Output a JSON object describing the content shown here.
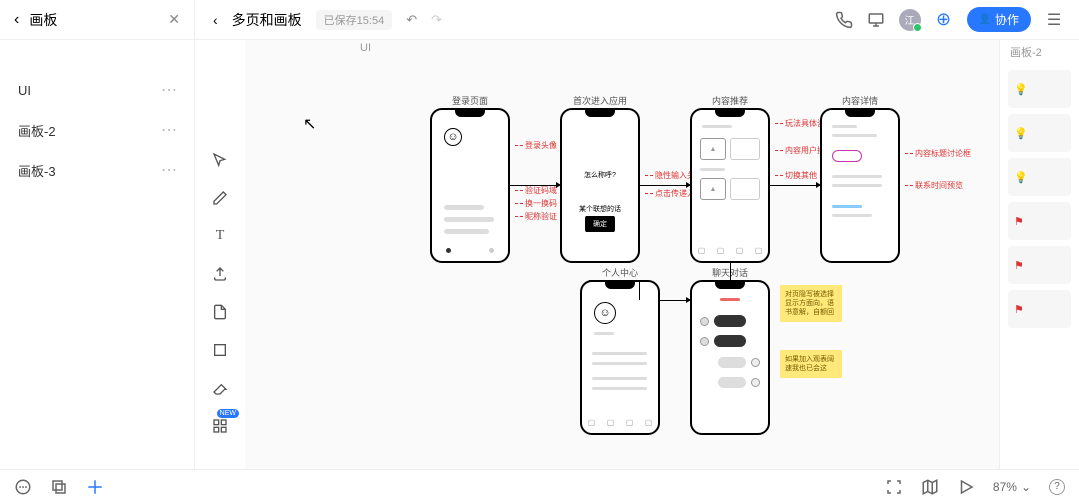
{
  "header": {
    "left_title": "画板",
    "doc_title": "多页和画板",
    "saved_label": "已保存15:54",
    "avatar_text": "江",
    "collab_label": "协作"
  },
  "sidebar": {
    "items": [
      {
        "label": "UI"
      },
      {
        "label": "画板-2"
      },
      {
        "label": "画板-3"
      }
    ]
  },
  "canvas": {
    "label_ui": "UI",
    "label_right": "画板-2",
    "phones": {
      "p1": "登录页面",
      "p2": "首次进入应用",
      "p3": "内容推荐",
      "p4": "内容详情",
      "p5": "个人中心",
      "p6": "聊天对话"
    },
    "p2_text1": "怎么称呼?",
    "p2_text2": "某个联想的话",
    "p2_btn": "确定",
    "annotations": {
      "a1": "登录头像",
      "a2": "验证码域",
      "a3": "换一换码",
      "a4": "昵称验证",
      "a5": "隐性输入关键词",
      "a6": "点击传递入库子",
      "a7": "玩法具体咨hah",
      "a8": "内容用户撰述标签",
      "a9": "切换其他",
      "a10": "内容标题讨论框",
      "a11": "联系时间预览"
    },
    "notes": {
      "n1": "对页隐写被选择显示方面向，语书意解，自额回",
      "n2": "如果加入观表阔速我也已会这"
    }
  },
  "zoom": "87%"
}
